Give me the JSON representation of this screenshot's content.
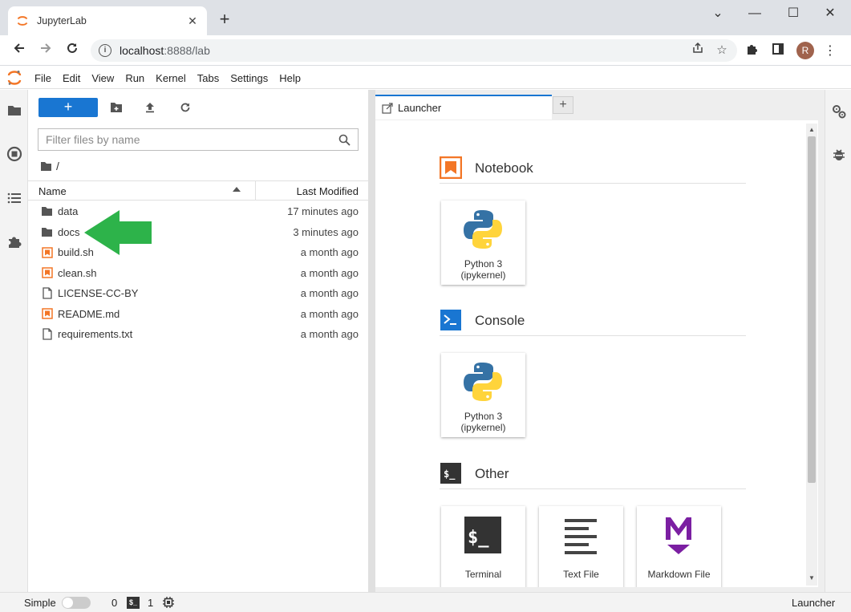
{
  "browser": {
    "tab_title": "JupyterLab",
    "tab_close": "✕",
    "new_tab": "+",
    "url_host": "localhost",
    "url_path": ":8888/lab",
    "avatar_letter": "R",
    "window_controls": [
      "⌄",
      "—",
      "☐",
      "✕"
    ]
  },
  "menu": {
    "items": [
      "File",
      "Edit",
      "View",
      "Run",
      "Kernel",
      "Tabs",
      "Settings",
      "Help"
    ]
  },
  "filebrowser": {
    "new_button": "+",
    "filter_placeholder": "Filter files by name",
    "breadcrumb": "/",
    "col_name": "Name",
    "col_modified": "Last Modified",
    "files": [
      {
        "name": "data",
        "modified": "17 minutes ago",
        "icon": "folder-icon"
      },
      {
        "name": "docs",
        "modified": "3 minutes ago",
        "icon": "folder-icon"
      },
      {
        "name": "build.sh",
        "modified": "a month ago",
        "icon": "script-file-icon"
      },
      {
        "name": "clean.sh",
        "modified": "a month ago",
        "icon": "script-file-icon"
      },
      {
        "name": "LICENSE-CC-BY",
        "modified": "a month ago",
        "icon": "file-icon"
      },
      {
        "name": "README.md",
        "modified": "a month ago",
        "icon": "markdown-file-icon"
      },
      {
        "name": "requirements.txt",
        "modified": "a month ago",
        "icon": "file-icon"
      }
    ]
  },
  "dock": {
    "tab_label": "Launcher",
    "add_tab": "+"
  },
  "launcher": {
    "notebook": {
      "title": "Notebook",
      "card_line1": "Python 3",
      "card_line2": "(ipykernel)"
    },
    "console": {
      "title": "Console",
      "card_line1": "Python 3",
      "card_line2": "(ipykernel)"
    },
    "other": {
      "title": "Other",
      "terminal": "Terminal",
      "textfile": "Text File",
      "markdown": "Markdown File"
    }
  },
  "status": {
    "mode": "Simple",
    "kernels": "0",
    "terminals": "1",
    "current": "Launcher"
  },
  "colors": {
    "accent": "#1976d2",
    "notebook_orange": "#f37626",
    "arrow_green": "#2db34a"
  }
}
